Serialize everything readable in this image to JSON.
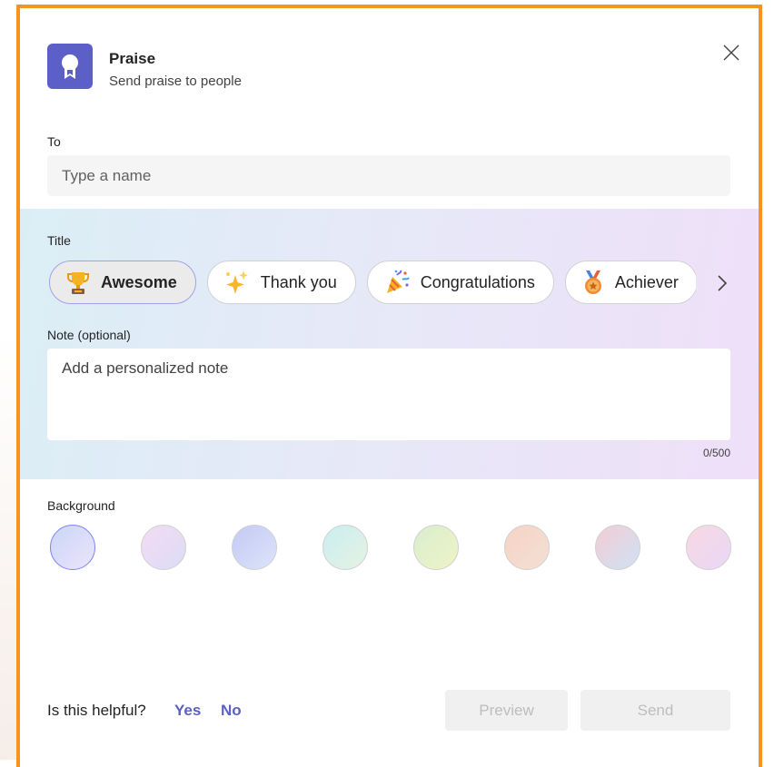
{
  "header": {
    "title": "Praise",
    "subtitle": "Send praise to people",
    "app_icon": "ribbon-award-icon",
    "close_icon": "close-icon"
  },
  "to": {
    "label": "To",
    "placeholder": "Type a name",
    "value": ""
  },
  "title_section": {
    "label": "Title",
    "badges": [
      {
        "label": "Awesome",
        "icon": "trophy-icon",
        "selected": true
      },
      {
        "label": "Thank you",
        "icon": "sparkles-icon",
        "selected": false
      },
      {
        "label": "Congratulations",
        "icon": "party-popper-icon",
        "selected": false
      },
      {
        "label": "Achiever",
        "icon": "medal-icon",
        "selected": false
      }
    ],
    "next_icon": "chevron-right-icon"
  },
  "note": {
    "label": "Note (optional)",
    "placeholder": "Add a personalized note",
    "value": "",
    "counter": "0/500"
  },
  "background": {
    "label": "Background",
    "selected_index": 0,
    "swatches": [
      {
        "colors": [
          "#c9d6f7",
          "#ece4fb"
        ]
      },
      {
        "colors": [
          "#f3dcf2",
          "#dcdcf6"
        ]
      },
      {
        "colors": [
          "#c3c9f4",
          "#dde4fa"
        ]
      },
      {
        "colors": [
          "#c9eef0",
          "#e6f2e2"
        ]
      },
      {
        "colors": [
          "#d9edd0",
          "#eef4c4"
        ]
      },
      {
        "colors": [
          "#f6d3c6",
          "#f3e0d2"
        ]
      },
      {
        "colors": [
          "#f3ccd4",
          "#cfe2f3"
        ]
      },
      {
        "colors": [
          "#f8d7e2",
          "#e8d9f6"
        ]
      }
    ]
  },
  "footer": {
    "helpful_text": "Is this helpful?",
    "yes_label": "Yes",
    "no_label": "No",
    "preview_label": "Preview",
    "send_label": "Send"
  },
  "colors": {
    "accent": "#5b5fc7",
    "frame": "#f7931e"
  }
}
